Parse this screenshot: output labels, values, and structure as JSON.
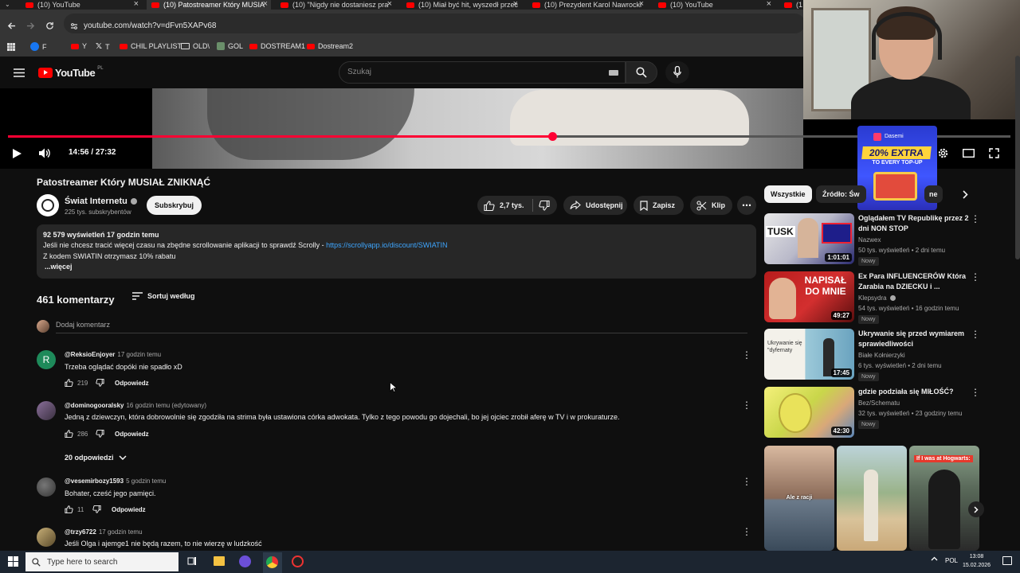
{
  "browser": {
    "tabs": [
      {
        "label": "(10) YouTube",
        "active": false
      },
      {
        "label": "(10) Patostreamer Który MUSIA",
        "active": true
      },
      {
        "label": "(10) \"Nigdy nie dostaniesz pra",
        "active": false
      },
      {
        "label": "(10) Miał być hit, wyszedł przec",
        "active": false
      },
      {
        "label": "(10) Prezydent Karol Nawrocki",
        "active": false
      },
      {
        "label": "(10) YouTube",
        "active": false
      },
      {
        "label": "(1",
        "active": false
      }
    ],
    "url": "youtube.com/watch?v=dFvn5XAPv68",
    "bookmarks": [
      "F",
      "Y",
      "T",
      "CHIL PLAYLIST",
      "OLD\\",
      "GOL",
      "DOSTREAM1",
      "Dostream2"
    ]
  },
  "header": {
    "logo_text": "YouTube",
    "logo_region": "PL",
    "search_placeholder": "Szukaj"
  },
  "player": {
    "time": "14:56 / 27:32",
    "progress_fraction": 0.543
  },
  "ad": {
    "brand": "Dasemi",
    "headline": "20% EXTRA",
    "subline": "TO EVERY TOP-UP"
  },
  "video": {
    "title": "Patostreamer Który MUSIAŁ ZNIKNĄĆ",
    "channel": "Świat Internetu",
    "subscribers": "225 tys. subskrybentów",
    "subscribe_label": "Subskrybuj",
    "likes": "2,7 tys.",
    "share_label": "Udostępnij",
    "save_label": "Zapisz",
    "clip_label": "Klip"
  },
  "description": {
    "stats": "92 579 wyświetleń  17 godzin temu",
    "line1": "Jeśli nie chcesz tracić więcej czasu na zbędne scrollowanie aplikacji to sprawdź Scrolly - ",
    "link": "https://scrollyapp.io/discount/SWIATIN",
    "line2": "Z kodem SWIATIN otrzymasz 10% rabatu",
    "more": "...więcej"
  },
  "comments": {
    "count_label": "461 komentarzy",
    "sort_label": "Sortuj według",
    "add_placeholder": "Dodaj komentarz",
    "reply_label": "Odpowiedz",
    "items": [
      {
        "author": "@ReksioEnjoyer",
        "time": "17 godzin temu",
        "text": "Trzeba oglądać dopóki nie spadło xD",
        "likes": "219",
        "avatar_letter": "R",
        "avatar_color": "#1e8a5a"
      },
      {
        "author": "@dominogooralsky",
        "time": "16 godzin temu (edytowany)",
        "text": "Jedną z dziewczyn, która dobrowolnie się zgodziła na strima była ustawiona córka adwokata. Tylko z tego powodu go dojechali, bo jej ojciec zrobił aferę w TV i w prokuraturze.",
        "likes": "286"
      },
      {
        "author": "@vesemirbozy1593",
        "time": "5 godzin temu",
        "text": "Bohater, cześć jego pamięci.",
        "likes": "11"
      },
      {
        "author": "@trzy6722",
        "time": "17 godzin temu",
        "text": "Jeśli Olga i ajemge1 nie będą razem, to nie wierzę w ludzkość"
      }
    ],
    "replies_label": "20 odpowiedzi"
  },
  "sidebar": {
    "chips": [
      "Wszystkie",
      "Źródło: Św",
      "ne"
    ],
    "videos": [
      {
        "title": "Oglądałem TV Republikę przez 2 dni NON STOP",
        "channel": "Nazwex",
        "meta": "50 tys. wyświetleń • 2 dni temu",
        "badge": "Nowy",
        "duration": "1:01:01",
        "thumb_text": "TUSK"
      },
      {
        "title": "Ex Para INFLUENCERÓW Która Zarabia na DZIECKU i ...",
        "channel": "Klepsydra",
        "meta": "54 tys. wyświetleń • 16 godzin temu",
        "badge": "Nowy",
        "duration": "49:27",
        "thumb_text": "NAPISAŁ DO MNIE"
      },
      {
        "title": "Ukrywanie się przed wymiarem sprawiedliwości",
        "channel": "Białe Kołnierzyki",
        "meta": "6 tys. wyświetleń • 2 dni temu",
        "badge": "Nowy",
        "duration": "17:45",
        "thumb_text": "Ukrywanie się \"dyfernaty"
      },
      {
        "title": "gdzie podziała się MIŁOŚĆ?",
        "channel": "Bez/Schematu",
        "meta": "32 tys. wyświetleń • 23 godziny temu",
        "badge": "Nowy",
        "duration": "42:30"
      }
    ],
    "shorts": [
      {
        "caption": "Ale z racji"
      },
      {
        "caption": ""
      },
      {
        "caption": "If I was at Hogwarts:"
      }
    ]
  },
  "taskbar": {
    "search_placeholder": "Type here to search",
    "lang": "POL",
    "time": "13:08",
    "date": "15.02.2026"
  }
}
